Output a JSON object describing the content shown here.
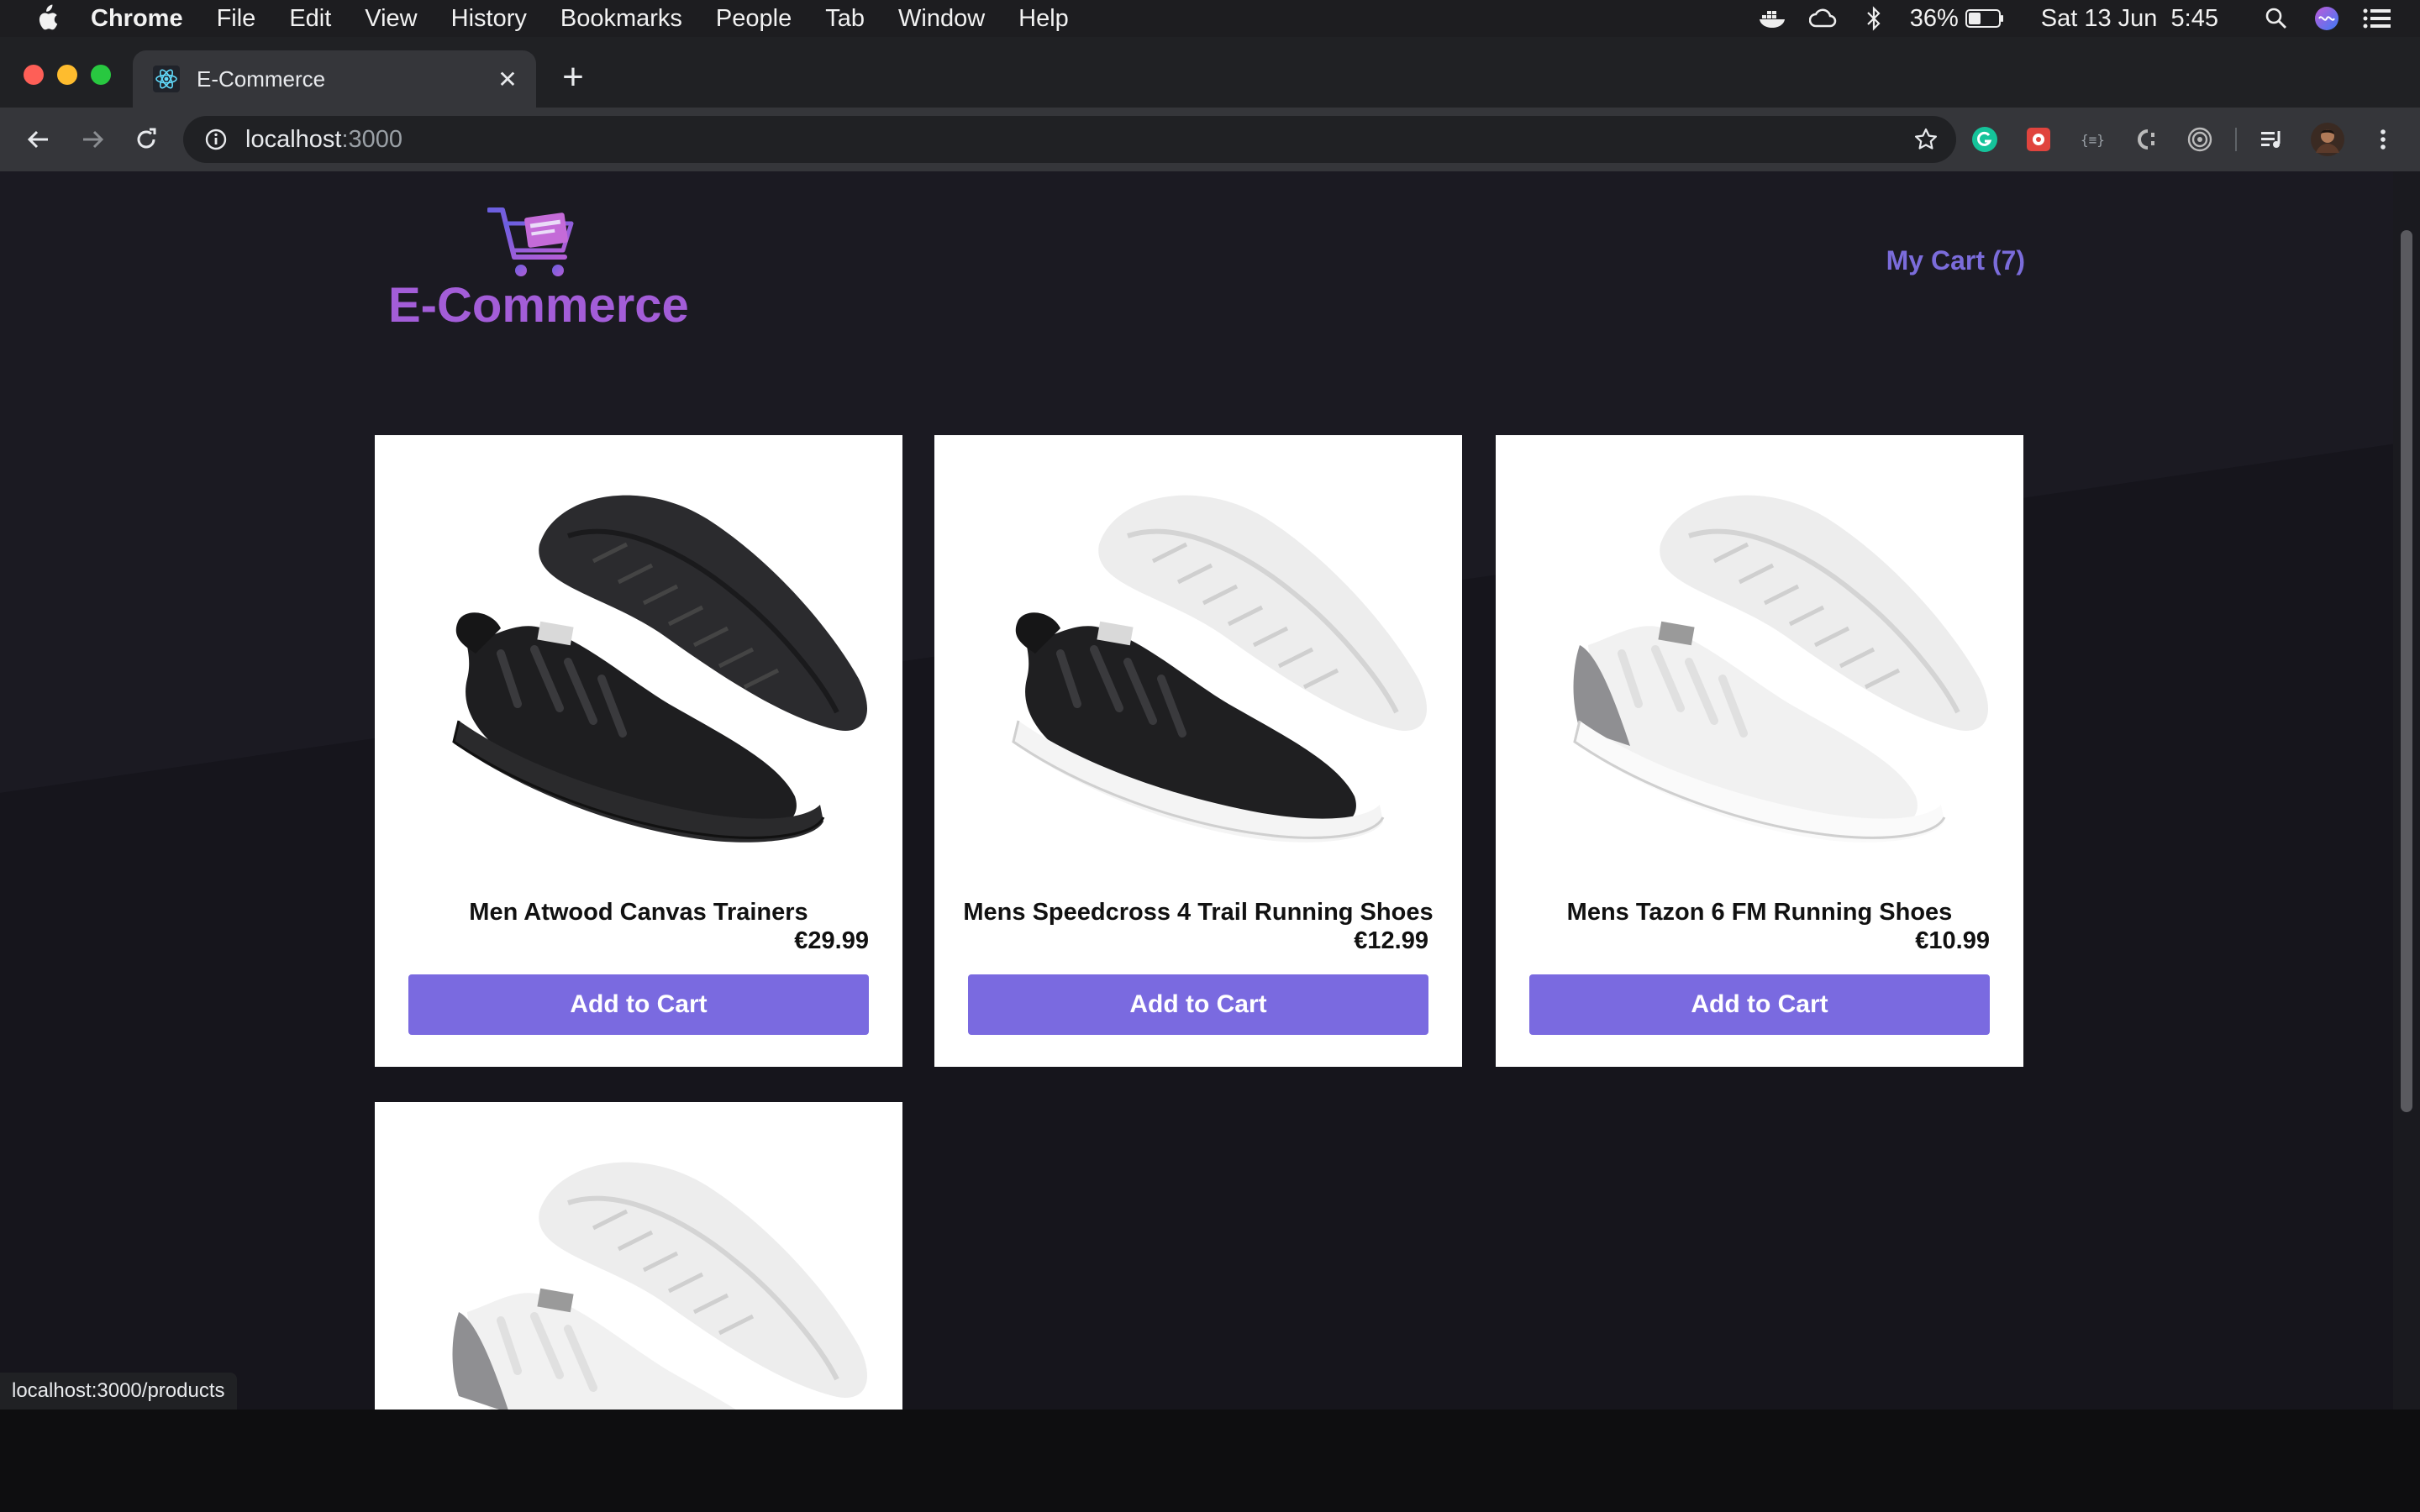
{
  "menubar": {
    "app_name": "Chrome",
    "items": [
      "File",
      "Edit",
      "View",
      "History",
      "Bookmarks",
      "People",
      "Tab",
      "Window",
      "Help"
    ],
    "battery": "36%",
    "clock": "Sat 13 Jun  5:45"
  },
  "browser": {
    "tab_title": "E-Commerce",
    "tab_close": "✕",
    "new_tab": "+",
    "url_host": "localhost",
    "url_port": ":3000",
    "status_url": "localhost:3000/products"
  },
  "site": {
    "logo_text": "E-Commerce",
    "cart_label": "My Cart (7)",
    "products": [
      {
        "name": "Men Atwood Canvas Trainers",
        "price": "€29.99",
        "button": "Add to Cart",
        "shoe": "black"
      },
      {
        "name": "Mens Speedcross 4 Trail Running Shoes",
        "price": "€12.99",
        "button": "Add to Cart",
        "shoe": "black-white"
      },
      {
        "name": "Mens Tazon 6 FM Running Shoes",
        "price": "€10.99",
        "button": "Add to Cart",
        "shoe": "white-grey"
      },
      {
        "name": "",
        "price": "",
        "button": "",
        "shoe": "white-grey"
      }
    ]
  },
  "colors": {
    "accent": "#7a6ae0",
    "logo": "#a35dd8",
    "page_bg": "#18171f"
  }
}
